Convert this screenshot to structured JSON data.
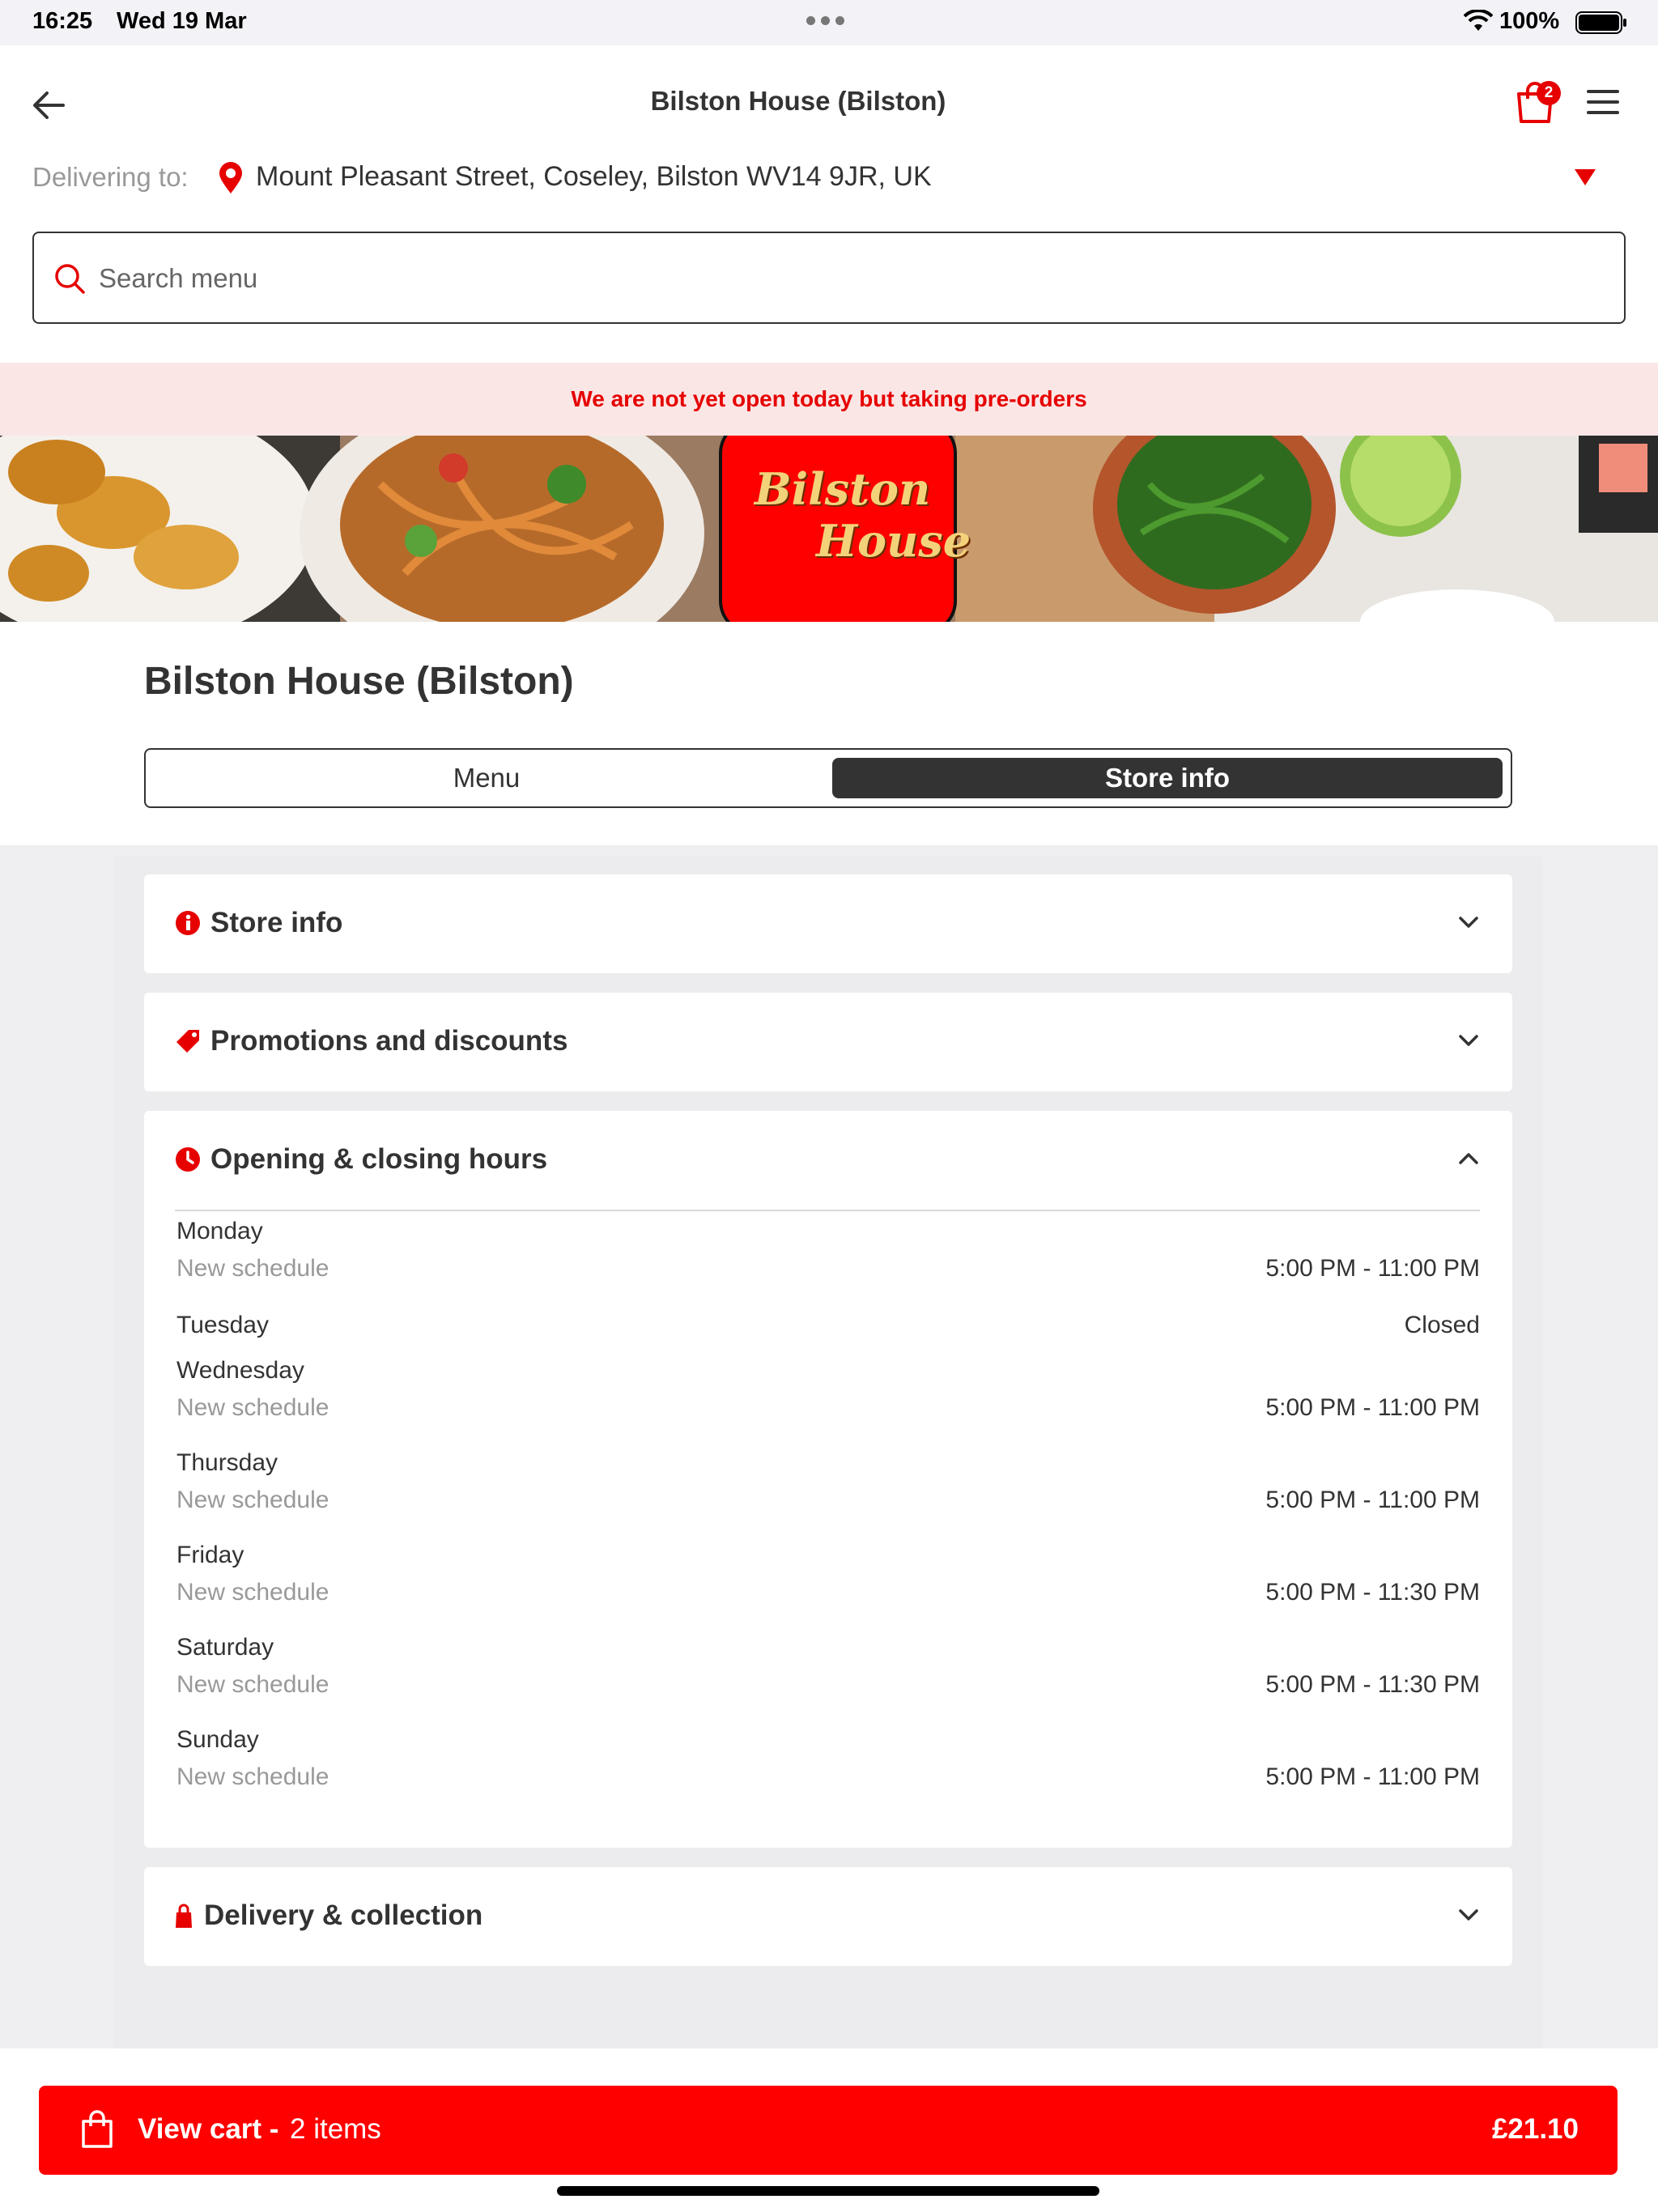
{
  "status_bar": {
    "time": "16:25",
    "date": "Wed 19 Mar",
    "battery": "100%"
  },
  "header": {
    "title": "Bilston House (Bilston)",
    "cart_badge": "2",
    "delivering_label": "Delivering to:",
    "address": "Mount Pleasant Street, Coseley, Bilston WV14 9JR, UK"
  },
  "search": {
    "placeholder": "Search menu",
    "value": ""
  },
  "notice": "We are not yet open today but taking pre-orders",
  "banner": {
    "logo_line1": "Bilston",
    "logo_line2": "House"
  },
  "store": {
    "name": "Bilston House (Bilston)",
    "tabs": [
      {
        "label": "Menu",
        "active": false
      },
      {
        "label": "Store info",
        "active": true
      }
    ]
  },
  "sections": {
    "store_info": "Store info",
    "promotions": "Promotions and discounts",
    "hours": "Opening & closing hours",
    "delivery": "Delivery & collection"
  },
  "hours": [
    {
      "day": "Monday",
      "note": "New schedule",
      "time": "5:00 PM - 11:00 PM"
    },
    {
      "day": "Tuesday",
      "note": "",
      "time": "Closed"
    },
    {
      "day": "Wednesday",
      "note": "New schedule",
      "time": "5:00 PM - 11:00 PM"
    },
    {
      "day": "Thursday",
      "note": "New schedule",
      "time": "5:00 PM - 11:00 PM"
    },
    {
      "day": "Friday",
      "note": "New schedule",
      "time": "5:00 PM - 11:30 PM"
    },
    {
      "day": "Saturday",
      "note": "New schedule",
      "time": "5:00 PM - 11:30 PM"
    },
    {
      "day": "Sunday",
      "note": "New schedule",
      "time": "5:00 PM - 11:00 PM"
    }
  ],
  "cart": {
    "label": "View cart - ",
    "count": "2 items",
    "total": "£21.10"
  },
  "colors": {
    "accent": "#ff0000",
    "notice_bg": "#fbe6e6",
    "tab_active": "#333333"
  },
  "icons": [
    "back-arrow-icon",
    "cart-icon",
    "hamburger-menu-icon",
    "location-pin-icon",
    "dropdown-triangle-icon",
    "search-icon",
    "info-icon",
    "tag-icon",
    "clock-icon",
    "bag-icon",
    "chevron-down-icon",
    "chevron-up-icon",
    "shopping-bag-icon"
  ]
}
